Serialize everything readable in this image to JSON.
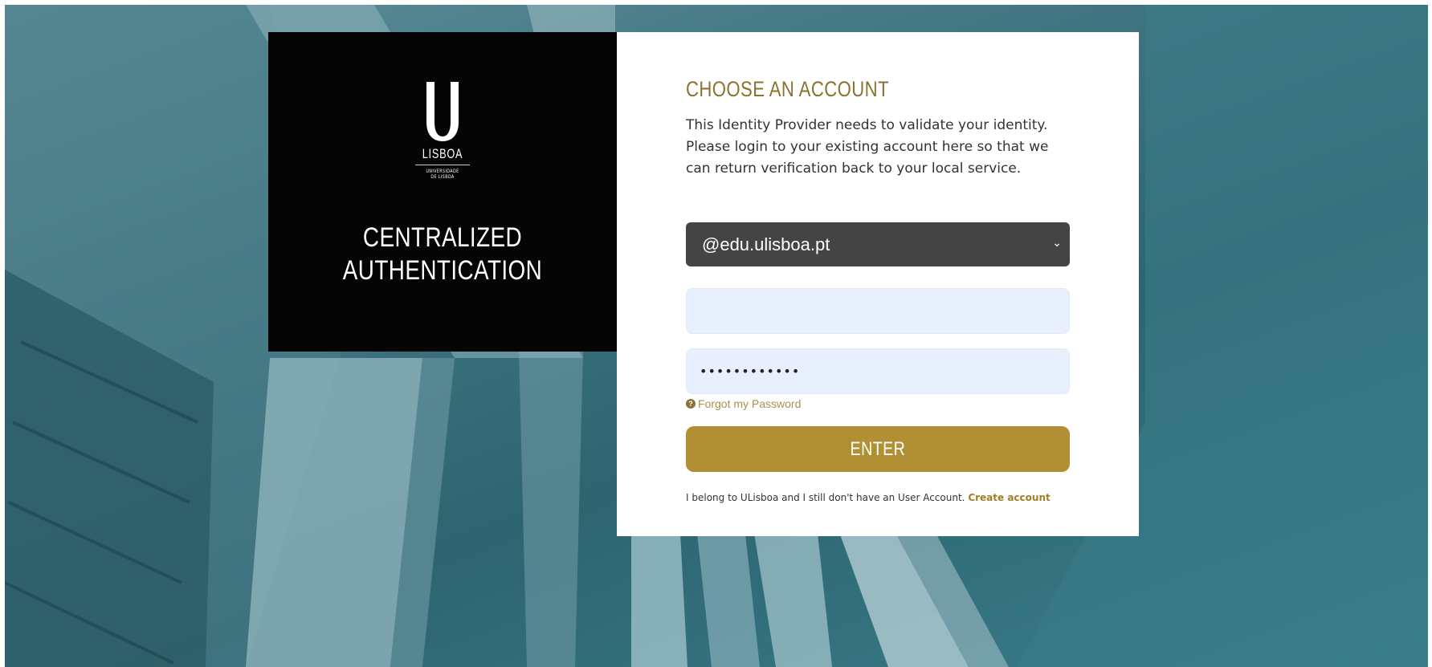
{
  "brand": {
    "logo_letter": "U",
    "logo_city": "LISBOA",
    "logo_sub_1": "UNIVERSIDADE",
    "logo_sub_2": "DE LISBOA",
    "title_line1": "CENTRALIZED",
    "title_line2": "AUTHENTICATION"
  },
  "login": {
    "heading": "CHOOSE AN ACCOUNT",
    "intro": "This Identity Provider needs to validate your identity. Please login to your existing account here so that we can return verification back to your local service.",
    "domain_selected": "@edu.ulisboa.pt",
    "username_value": "",
    "password_value": "••••••••••••",
    "forgot_label": "Forgot my Password",
    "enter_label": "ENTER",
    "signup_text": "I belong to ULisboa and I still don't have an User Account.",
    "signup_link": "Create account"
  },
  "colors": {
    "accent_gold": "#b18f35",
    "heading_gold": "#8b7230",
    "select_bg": "#444444",
    "field_bg": "#e8f0fd",
    "brand_bg": "#050505",
    "background_teal": "#3f7480"
  },
  "icons": {
    "select_chevron": "chevron-down-icon",
    "forgot_help": "question-circle-icon"
  }
}
